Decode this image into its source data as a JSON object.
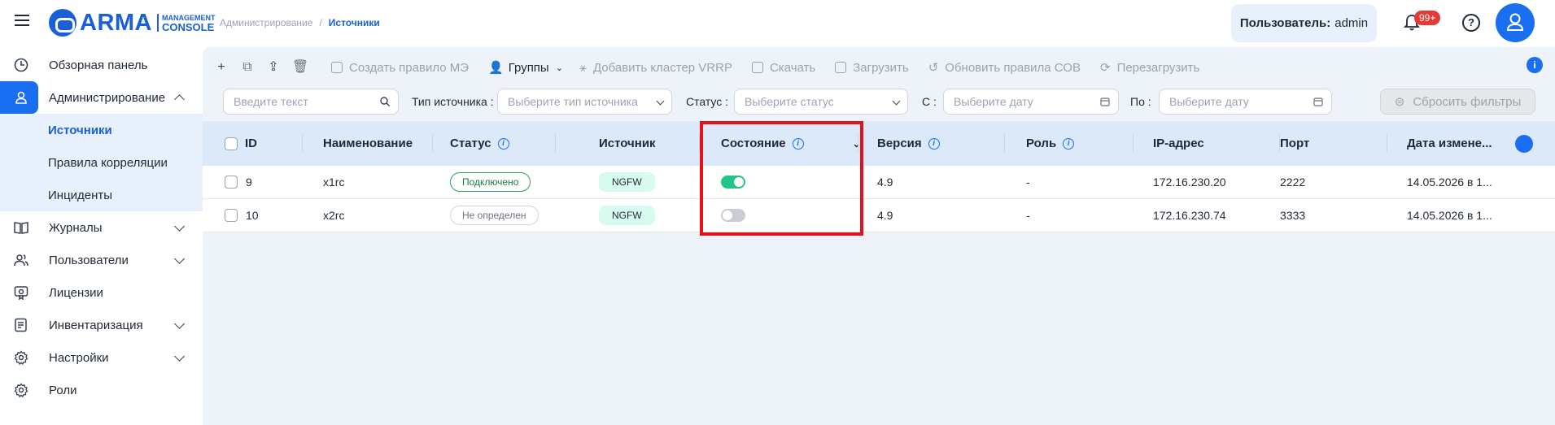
{
  "header": {
    "logo_word": "ARMA",
    "logo_sub1": "MANAGEMENT",
    "logo_sub2": "CONSOLE",
    "breadcrumb": [
      "Администрирование",
      "/",
      "Источники"
    ],
    "user_label": "Пользователь:",
    "user_name": "admin",
    "notifications_badge": "99+",
    "help": "?"
  },
  "sidebar": {
    "items": [
      {
        "label": "Обзорная панель",
        "icon": "dashboard-icon"
      },
      {
        "label": "Администрирование",
        "icon": "admin-user-icon",
        "expanded": true
      },
      {
        "label": "Журналы",
        "icon": "book-icon"
      },
      {
        "label": "Пользователи",
        "icon": "users-icon"
      },
      {
        "label": "Лицензии",
        "icon": "license-icon"
      },
      {
        "label": "Инвентаризация",
        "icon": "inventory-icon"
      },
      {
        "label": "Настройки",
        "icon": "gear-icon"
      },
      {
        "label": "Роли",
        "icon": "roles-gear-icon"
      }
    ],
    "sub_items": [
      "Источники",
      "Правила корреляции",
      "Инциденты"
    ]
  },
  "toolbar": {
    "create_rule": "Создать правило МЭ",
    "groups": "Группы",
    "add_vrrp": "Добавить кластер VRRP",
    "download": "Скачать",
    "upload": "Загрузить",
    "update_sov": "Обновить правила СОВ",
    "reload": "Перезагрузить"
  },
  "filters": {
    "search_placeholder": "Введите текст",
    "source_type_label": "Тип источника :",
    "source_type_placeholder": "Выберите тип источника",
    "status_label": "Статус :",
    "status_placeholder": "Выберите статус",
    "from_label": "С :",
    "from_placeholder": "Выберите дату",
    "to_label": "По :",
    "to_placeholder": "Выберите дату",
    "reset": "Сбросить фильтры"
  },
  "table": {
    "headers": {
      "id": "ID",
      "name": "Наименование",
      "status": "Статус",
      "source": "Источник",
      "state": "Состояние",
      "version": "Версия",
      "role": "Роль",
      "ip": "IP-адрес",
      "port": "Порт",
      "date": "Дата измене..."
    },
    "rows": [
      {
        "id": "9",
        "name": "x1rc",
        "status": "Подключено",
        "source": "NGFW",
        "state_on": true,
        "version": "4.9",
        "role": "-",
        "ip": "172.16.230.20",
        "port": "2222",
        "date": "14.05.2026 в 1..."
      },
      {
        "id": "10",
        "name": "x2rc",
        "status": "Не определен",
        "source": "NGFW",
        "state_on": false,
        "version": "4.9",
        "role": "-",
        "ip": "172.16.230.74",
        "port": "3333",
        "date": "14.05.2026 в 1..."
      }
    ]
  },
  "colors": {
    "accent": "#1a6ef0",
    "highlight": "#e3131b",
    "toggle_on": "#22c585"
  }
}
